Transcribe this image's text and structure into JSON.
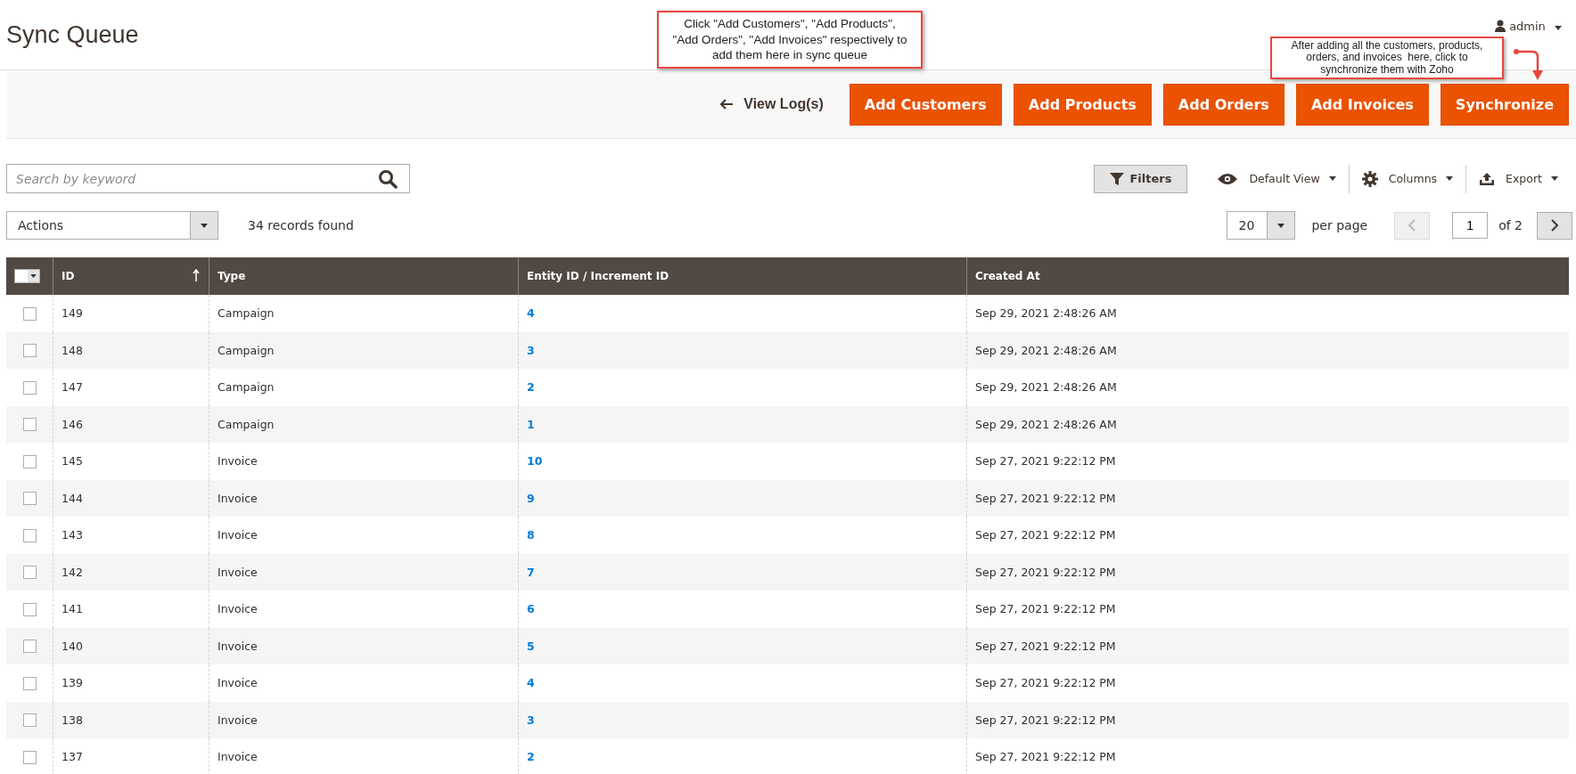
{
  "page_title": "Sync Queue",
  "user": {
    "name": "admin"
  },
  "callouts": [
    {
      "text": "Click \"Add Customers\", \"Add Products\", \"Add Orders\", \"Add Invoices\" respectively to add them here in sync queue",
      "kind": "plain"
    },
    {
      "text": "After adding all the customers, products, orders, and invoices  here, click to synchronize them with Zoho",
      "kind": "arrow"
    }
  ],
  "action_bar": {
    "back_link": "View Log(s)",
    "buttons": [
      "Add Customers",
      "Add Products",
      "Add Orders",
      "Add Invoices",
      "Synchronize"
    ]
  },
  "search": {
    "placeholder": "Search by keyword"
  },
  "toolbar": {
    "filters": "Filters",
    "view": "Default View",
    "columns": "Columns",
    "export": "Export"
  },
  "mass_actions": {
    "value": "Actions"
  },
  "records_found": "34 records found",
  "pagination": {
    "per_page_value": "20",
    "per_page_label": "per page",
    "page": "1",
    "of": "of 2",
    "prev_disabled": true
  },
  "table": {
    "columns": [
      "ID",
      "Type",
      "Entity ID / Increment ID",
      "Created At"
    ],
    "rows": [
      {
        "id": "149",
        "type": "Campaign",
        "entity": "4",
        "created": "Sep 29, 2021 2:48:26 AM",
        "checked": false
      },
      {
        "id": "148",
        "type": "Campaign",
        "entity": "3",
        "created": "Sep 29, 2021 2:48:26 AM",
        "checked": false
      },
      {
        "id": "147",
        "type": "Campaign",
        "entity": "2",
        "created": "Sep 29, 2021 2:48:26 AM",
        "checked": false
      },
      {
        "id": "146",
        "type": "Campaign",
        "entity": "1",
        "created": "Sep 29, 2021 2:48:26 AM",
        "checked": false
      },
      {
        "id": "145",
        "type": "Invoice",
        "entity": "10",
        "created": "Sep 27, 2021 9:22:12 PM",
        "checked": false
      },
      {
        "id": "144",
        "type": "Invoice",
        "entity": "9",
        "created": "Sep 27, 2021 9:22:12 PM",
        "checked": false
      },
      {
        "id": "143",
        "type": "Invoice",
        "entity": "8",
        "created": "Sep 27, 2021 9:22:12 PM",
        "checked": false
      },
      {
        "id": "142",
        "type": "Invoice",
        "entity": "7",
        "created": "Sep 27, 2021 9:22:12 PM",
        "checked": false
      },
      {
        "id": "141",
        "type": "Invoice",
        "entity": "6",
        "created": "Sep 27, 2021 9:22:12 PM",
        "checked": false
      },
      {
        "id": "140",
        "type": "Invoice",
        "entity": "5",
        "created": "Sep 27, 2021 9:22:12 PM",
        "checked": false
      },
      {
        "id": "139",
        "type": "Invoice",
        "entity": "4",
        "created": "Sep 27, 2021 9:22:12 PM",
        "checked": false
      },
      {
        "id": "138",
        "type": "Invoice",
        "entity": "3",
        "created": "Sep 27, 2021 9:22:12 PM",
        "checked": false
      },
      {
        "id": "137",
        "type": "Invoice",
        "entity": "2",
        "created": "Sep 27, 2021 9:22:12 PM",
        "checked": false
      }
    ]
  }
}
